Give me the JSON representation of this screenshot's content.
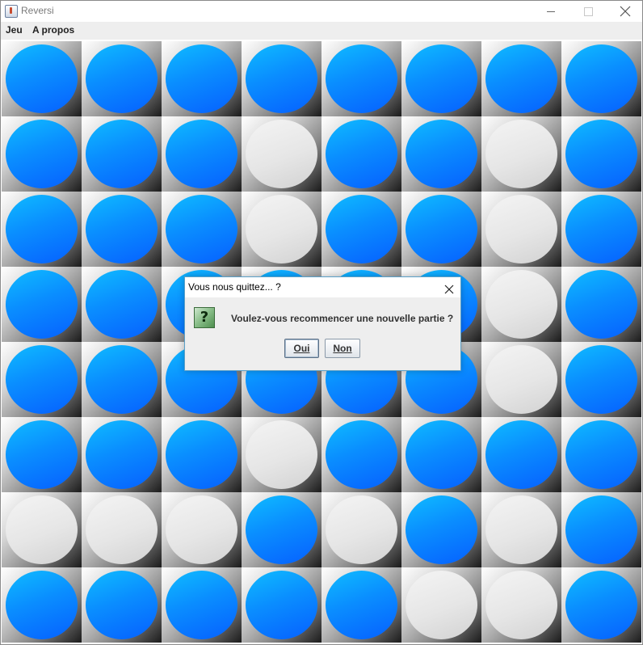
{
  "window": {
    "title": "Reversi",
    "app_icon": "java-cup-icon"
  },
  "menu": {
    "items": [
      {
        "label": "Jeu"
      },
      {
        "label": "A propos"
      }
    ]
  },
  "board": {
    "rows": 8,
    "cols": 8,
    "cells": [
      [
        "blue",
        "blue",
        "blue",
        "blue",
        "blue",
        "blue",
        "blue",
        "blue"
      ],
      [
        "blue",
        "blue",
        "blue",
        "white",
        "blue",
        "blue",
        "white",
        "blue"
      ],
      [
        "blue",
        "blue",
        "blue",
        "white",
        "blue",
        "blue",
        "white",
        "blue"
      ],
      [
        "blue",
        "blue",
        "blue",
        "blue",
        "blue",
        "blue",
        "white",
        "blue"
      ],
      [
        "blue",
        "blue",
        "blue",
        "blue",
        "blue",
        "blue",
        "white",
        "blue"
      ],
      [
        "blue",
        "blue",
        "blue",
        "white",
        "blue",
        "blue",
        "blue",
        "blue"
      ],
      [
        "white",
        "white",
        "white",
        "blue",
        "white",
        "blue",
        "white",
        "blue"
      ],
      [
        "blue",
        "blue",
        "blue",
        "blue",
        "blue",
        "white",
        "white",
        "blue"
      ]
    ],
    "colors": {
      "blue": "#0a8dff",
      "white": "#e6e6e6"
    }
  },
  "dialog": {
    "title": "Vous nous quittez... ?",
    "icon": "question-icon",
    "icon_glyph": "?",
    "message": "Voulez-vous recommencer une nouvelle partie ?",
    "buttons": {
      "yes": "Oui",
      "no": "Non"
    }
  }
}
